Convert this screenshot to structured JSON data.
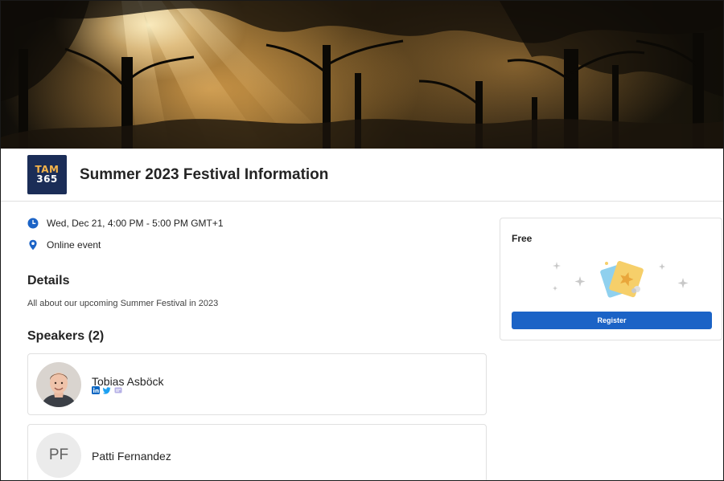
{
  "event": {
    "title": "Summer 2023 Festival Information",
    "logo_text_top": "TAM",
    "logo_text_bottom": "365",
    "datetime": "Wed, Dec 21, 4:00 PM - 5:00 PM GMT+1",
    "location": "Online event"
  },
  "icons": {
    "clock": "clock-icon",
    "location": "location-pin-icon",
    "linkedin": "linkedin-icon",
    "twitter": "twitter-icon",
    "website": "web-icon"
  },
  "details": {
    "heading": "Details",
    "description": "All about our upcoming Summer Festival in 2023"
  },
  "speakers": {
    "heading": "Speakers (2)",
    "items": [
      {
        "name": "Tobias Asböck",
        "has_photo": true,
        "socials": [
          "linkedin",
          "twitter",
          "website"
        ]
      },
      {
        "name": "Patti Fernandez",
        "initials": "PF"
      }
    ]
  },
  "registration": {
    "price": "Free",
    "button_label": "Register"
  },
  "colors": {
    "accent": "#1b63c6",
    "logo_bg": "#1b2d57",
    "logo_text": "#f6b44a",
    "linkedin": "#0a66c2",
    "twitter": "#1da1f2"
  }
}
